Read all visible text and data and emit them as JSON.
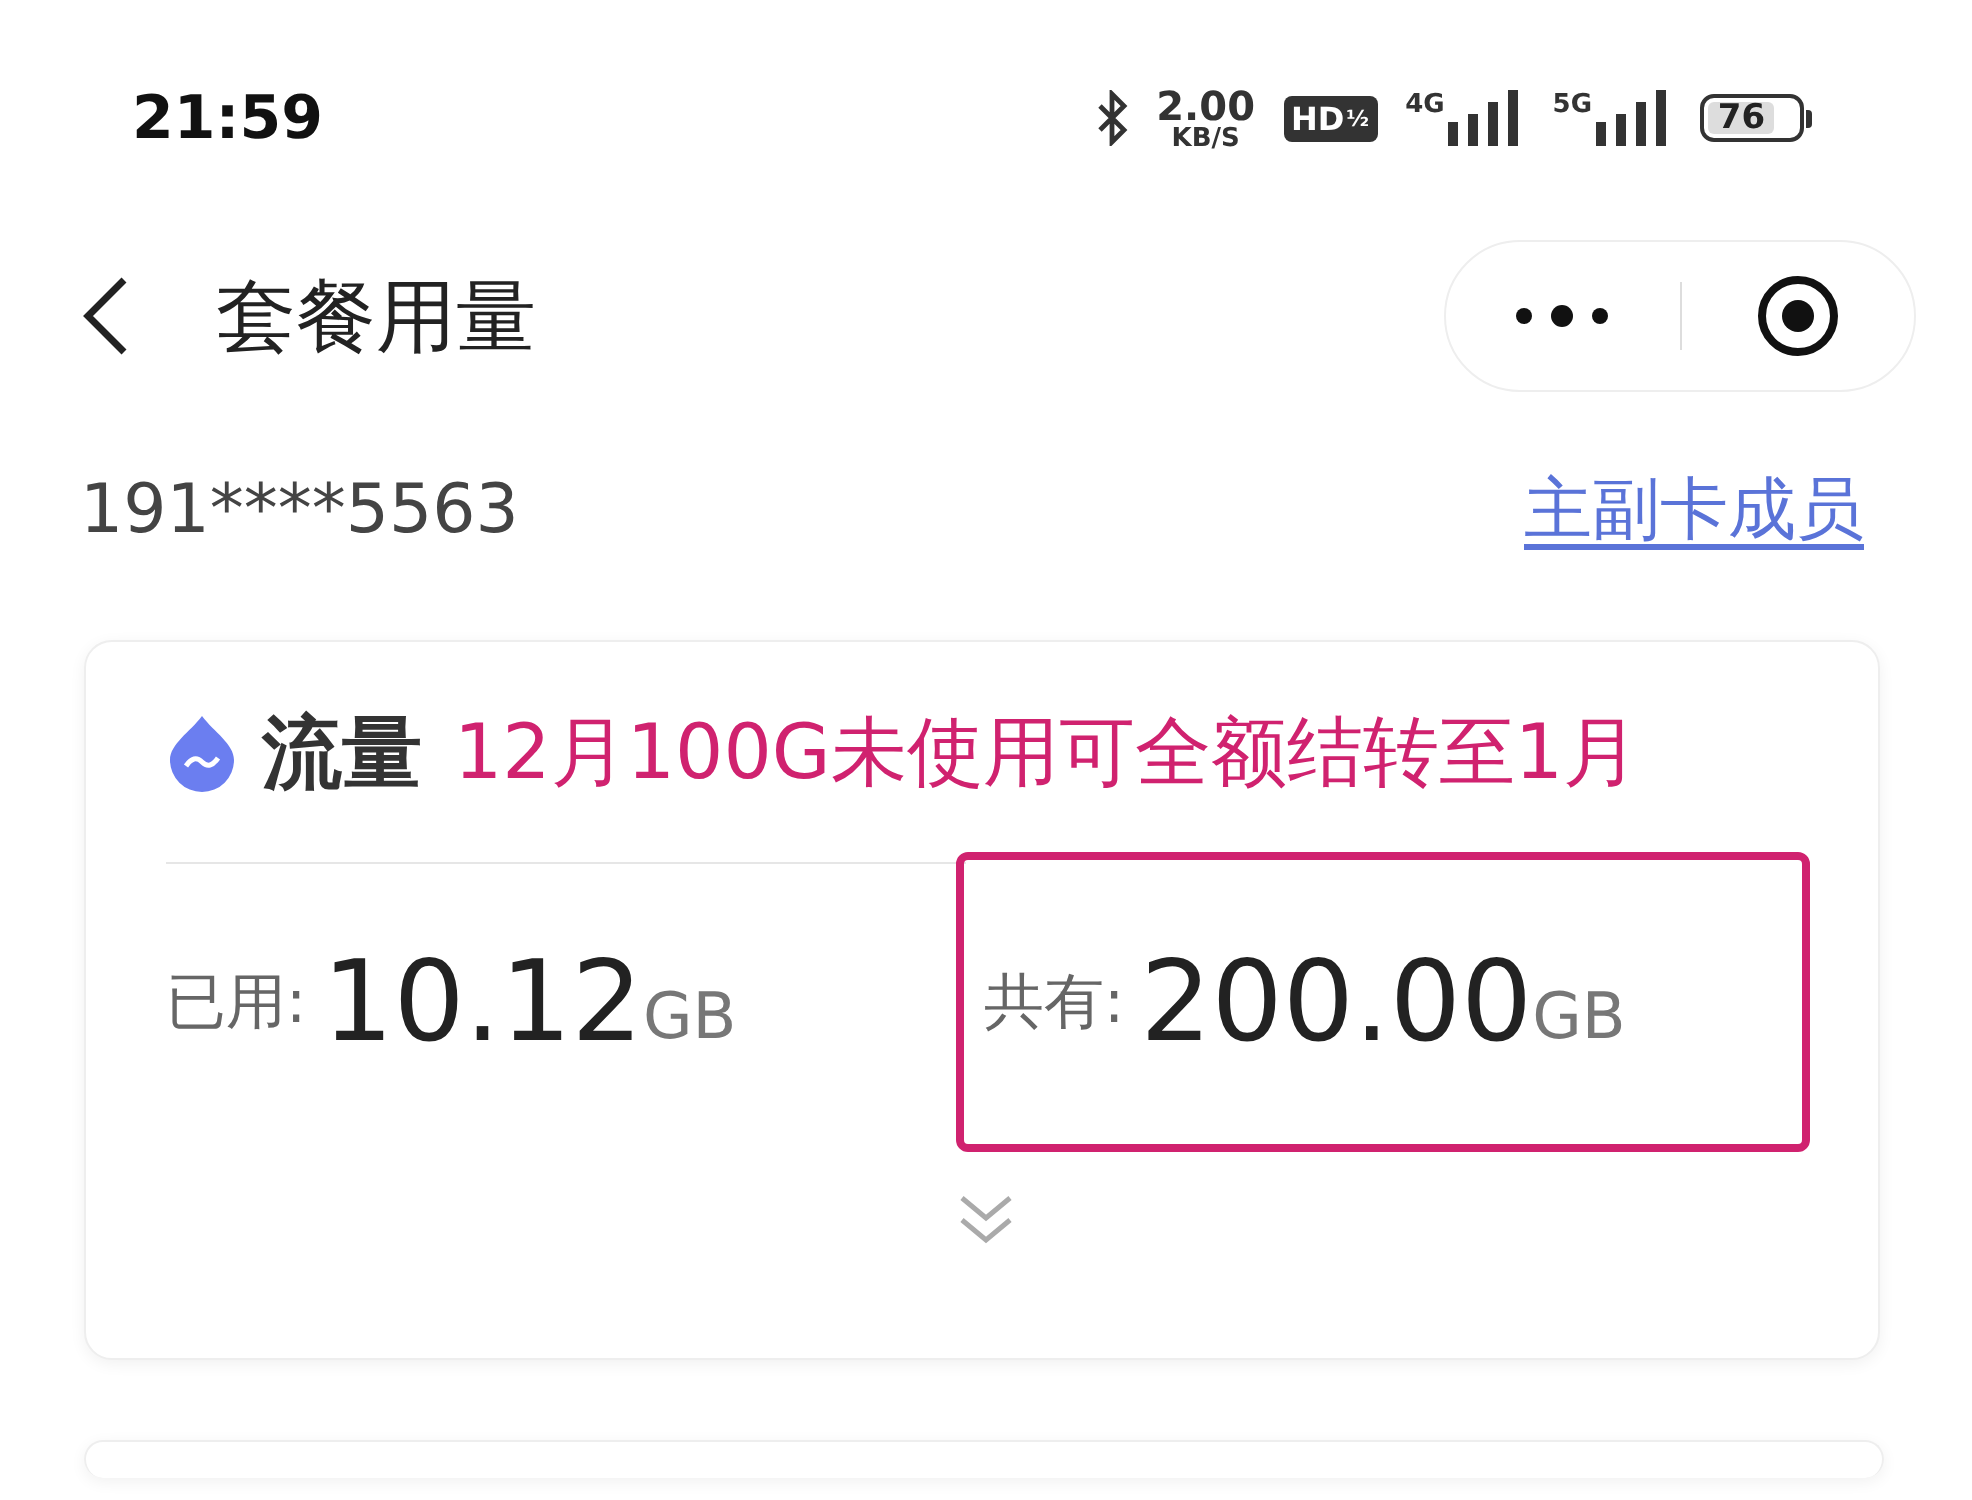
{
  "status_bar": {
    "time": "21:59",
    "speed_value": "2.00",
    "speed_unit": "KB/S",
    "hd_badge": "HD",
    "hd_sub": "½",
    "networks": [
      "4G",
      "5G"
    ],
    "battery": "76"
  },
  "nav": {
    "title": "套餐用量"
  },
  "account": {
    "phone": "191****5563",
    "link": "主副卡成员"
  },
  "data_card": {
    "title": "流量",
    "annotation": "12月100G未使用可全额结转至1月",
    "stats": [
      {
        "label": "已用:",
        "value": "10.12",
        "unit": "GB",
        "highlighted": false
      },
      {
        "label": "共有:",
        "value": "200.00",
        "unit": "GB",
        "highlighted": true
      }
    ]
  }
}
